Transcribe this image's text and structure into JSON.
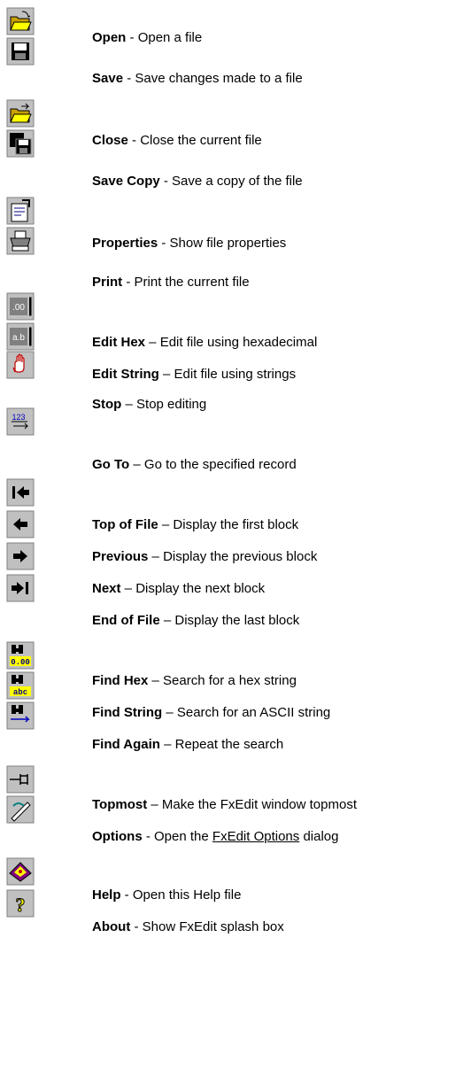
{
  "items": [
    {
      "name": "Open",
      "sep": " - ",
      "desc": "Open a file",
      "icon": "open-folder-icon"
    },
    {
      "name": "Save",
      "sep": " - ",
      "desc": "Save changes made to a file",
      "icon": "floppy-disk-icon"
    },
    {
      "name": "Close",
      "sep": " - ",
      "desc": "Close the current file",
      "icon": "close-folder-icon"
    },
    {
      "name": "Save Copy",
      "sep": " - ",
      "desc": "Save a copy of the file",
      "icon": "save-copy-icon"
    },
    {
      "name": "Properties",
      "sep": " - ",
      "desc": "Show file properties",
      "icon": "properties-icon"
    },
    {
      "name": "Print",
      "sep": " - ",
      "desc": "Print the current file",
      "icon": "printer-icon"
    },
    {
      "name": "Edit Hex",
      "sep": " – ",
      "desc": "Edit file using hexadecimal",
      "icon": "edit-hex-icon"
    },
    {
      "name": "Edit String",
      "sep": " – ",
      "desc": "Edit file using strings",
      "icon": "edit-string-icon"
    },
    {
      "name": "Stop",
      "sep": " – ",
      "desc": "Stop editing",
      "icon": "stop-hand-icon"
    },
    {
      "name": "Go To",
      "sep": " – ",
      "desc": "Go to the specified record",
      "icon": "goto-record-icon"
    },
    {
      "name": "Top of File",
      "sep": " – ",
      "desc": "Display the first block",
      "icon": "first-block-icon"
    },
    {
      "name": "Previous",
      "sep": " – ",
      "desc": "Display the previous block",
      "icon": "previous-block-icon"
    },
    {
      "name": "Next",
      "sep": " – ",
      "desc": "Display the next block",
      "icon": "next-block-icon"
    },
    {
      "name": "End of File",
      "sep": " – ",
      "desc": "Display the last block",
      "icon": "last-block-icon"
    },
    {
      "name": "Find Hex",
      "sep": " – ",
      "desc": "Search for a hex string",
      "icon": "find-hex-icon"
    },
    {
      "name": "Find String",
      "sep": " – ",
      "desc": "Search for an ASCII string",
      "icon": "find-string-icon"
    },
    {
      "name": "Find Again",
      "sep": " – ",
      "desc": "Repeat the search",
      "icon": "find-again-icon"
    },
    {
      "name": "Topmost",
      "sep": " – ",
      "desc": "Make the FxEdit window topmost",
      "icon": "pin-topmost-icon"
    },
    {
      "name": "Options",
      "sep": " - ",
      "desc": "Open the ",
      "link": "FxEdit Options",
      "desc_after": " dialog",
      "icon": "options-icon"
    },
    {
      "name": "Help",
      "sep": " - ",
      "desc": "Open this Help file",
      "icon": "help-book-icon"
    },
    {
      "name": "About",
      "sep": " - ",
      "desc": "Show FxEdit splash box",
      "icon": "about-question-icon"
    }
  ],
  "icon_glyphs": {
    "edit_hex": ".00",
    "edit_string": "a.b",
    "goto": "123",
    "find_hex": "0.00",
    "find_string": "abc"
  }
}
